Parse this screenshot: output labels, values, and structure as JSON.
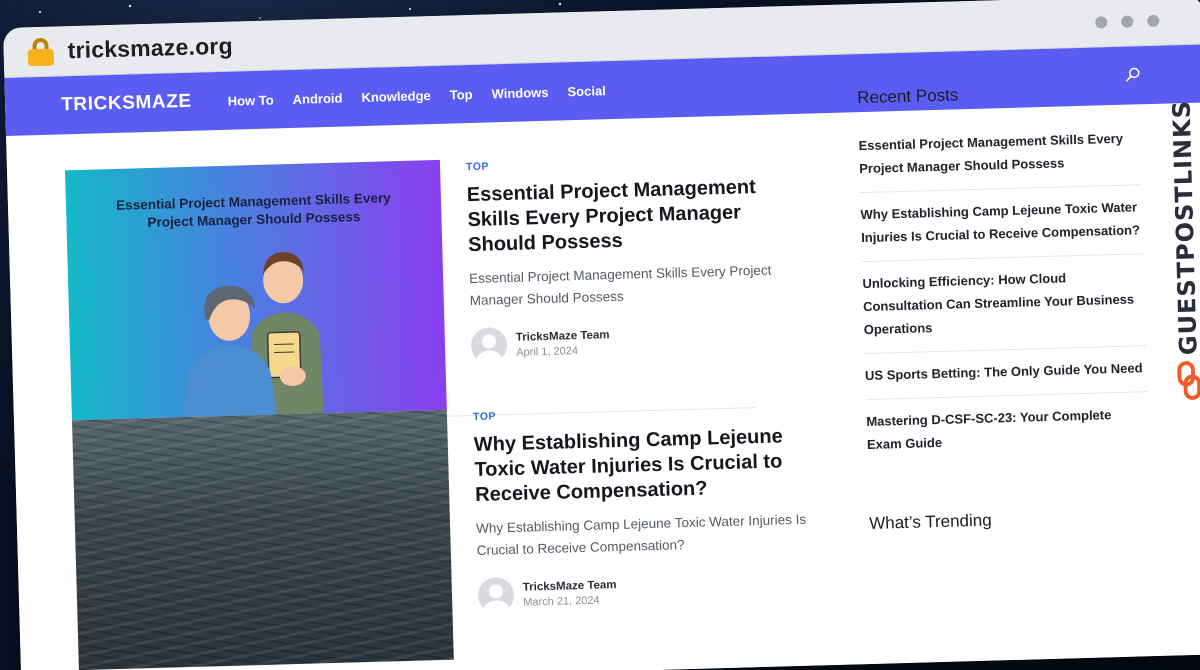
{
  "browser": {
    "url": "tricksmaze.org",
    "lock_icon": "lock-icon",
    "window_dots": [
      "dot",
      "dot",
      "dot"
    ]
  },
  "site": {
    "brand": "TRICKSMAZE",
    "nav": [
      {
        "label": "How To"
      },
      {
        "label": "Android"
      },
      {
        "label": "Knowledge"
      },
      {
        "label": "Top"
      },
      {
        "label": "Windows"
      },
      {
        "label": "Social"
      }
    ],
    "search_icon": "search-icon",
    "accent_color": "#5a5df2",
    "category_color": "#2f6fe0"
  },
  "posts": [
    {
      "category": "TOP",
      "thumb_text": "Essential Project Management Skills Every Project Manager Should Possess",
      "title": "Essential Project Management Skills Every Project Manager Should Possess",
      "excerpt": "Essential Project Management Skills Every Project Manager Should Possess",
      "author": "TricksMaze Team",
      "date": "April 1, 2024"
    },
    {
      "category": "TOP",
      "title": "Why Establishing Camp Lejeune Toxic Water Injuries Is Crucial to Receive Compensation?",
      "excerpt": "Why Establishing Camp Lejeune Toxic Water Injuries Is Crucial to Receive Compensation?",
      "author": "TricksMaze Team",
      "date": "March 21, 2024"
    }
  ],
  "sidebar": {
    "recent_heading": "Recent Posts",
    "recent": [
      "Essential Project Management Skills Every Project Manager Should Possess",
      "Why Establishing Camp Lejeune Toxic Water Injuries Is Crucial to Receive Compensation?",
      "Unlocking Efficiency: How Cloud Consultation Can Streamline Your Business Operations",
      "US Sports Betting: The Only Guide You Need",
      "Mastering D-CSF-SC-23: Your Complete Exam Guide"
    ],
    "trending_heading": "What’s Trending"
  },
  "watermark": {
    "text": "GUESTPOSTLINKS",
    "color": "#f25a2a"
  }
}
